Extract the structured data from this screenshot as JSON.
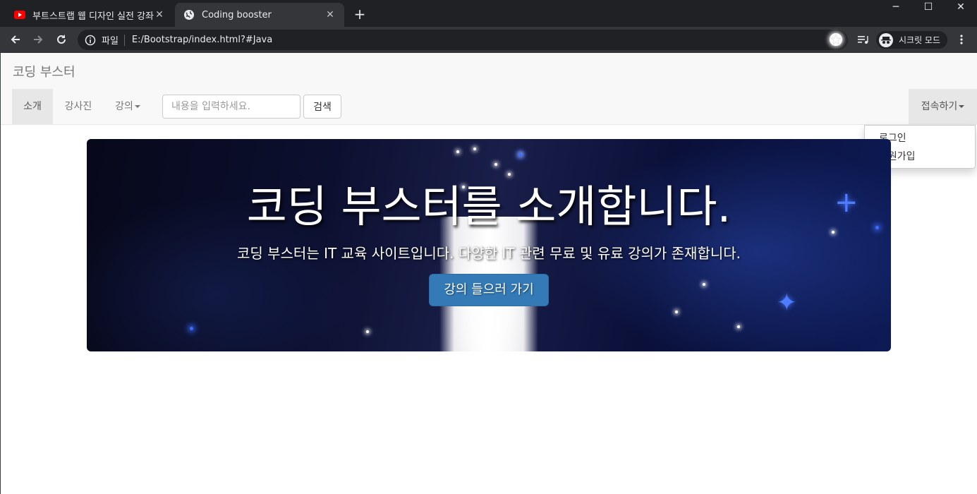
{
  "browser": {
    "tabs": [
      {
        "title": "부트스트랩 웹 디자인 실전 강좌",
        "favicon": "youtube-icon",
        "active": false
      },
      {
        "title": "Coding booster",
        "favicon": "globe-icon",
        "active": true
      }
    ],
    "new_tab_label": "+",
    "omnibox": {
      "scheme_label": "파일",
      "url": "E:/Bootstrap/index.html?#Java"
    },
    "incognito_label": "시크릿 모드",
    "colors": {
      "tabbar": "#202124",
      "toolbar": "#35363a",
      "text": "#e8eaed"
    }
  },
  "navbar": {
    "brand": "코딩 부스터",
    "items": [
      {
        "label": "소개",
        "active": true
      },
      {
        "label": "강사진",
        "active": false
      },
      {
        "label": "강의",
        "dropdown": true
      }
    ],
    "search": {
      "placeholder": "내용을 입력하세요.",
      "value": "",
      "button": "검색"
    },
    "right": {
      "label": "접속하기",
      "dropdown_open": true
    }
  },
  "dropdown": {
    "items": [
      "로그인",
      "회원가입"
    ]
  },
  "jumbotron": {
    "title": "코딩 부스터를 소개합니다.",
    "subtitle": "코딩 부스터는 IT 교육 사이트입니다. 다양한 IT 관련 무료 및 유료 강의가 존재합니다.",
    "button": "강의 들으러 가기",
    "colors": {
      "button": "#337ab7"
    }
  }
}
